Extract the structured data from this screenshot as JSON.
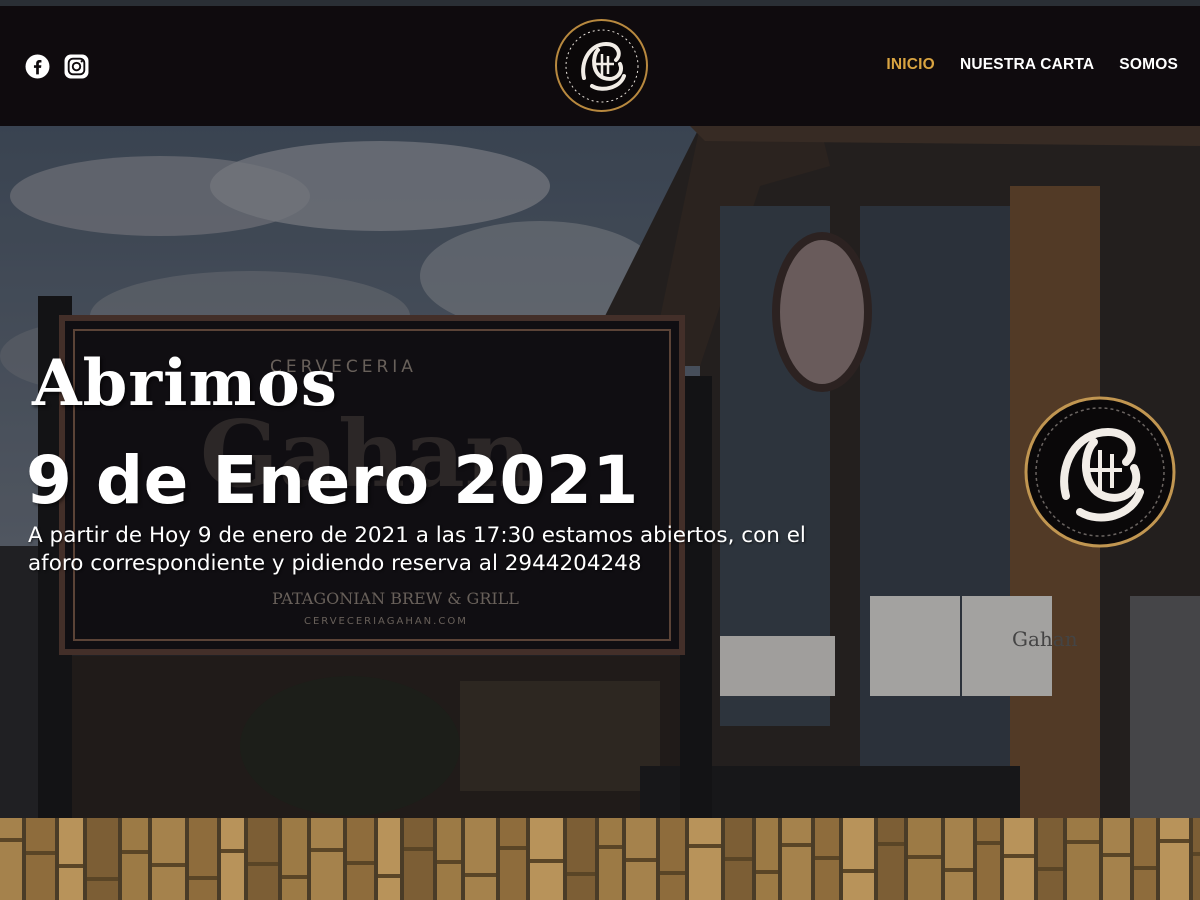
{
  "header": {
    "social": [
      {
        "name": "facebook",
        "icon": "facebook-icon"
      },
      {
        "name": "instagram",
        "icon": "instagram-icon"
      }
    ],
    "logo_icon": "gahan-logo-icon",
    "nav": [
      {
        "label": "INICIO",
        "active": true
      },
      {
        "label": "NUESTRA CARTA",
        "active": false
      },
      {
        "label": "SOMOS",
        "active": false
      }
    ]
  },
  "hero": {
    "title": "Abrimos",
    "date": "9 de Enero 2021",
    "text": "A partir de Hoy 9 de enero de 2021 a las 17:30 estamos abiertos, con el aforo correspondiente y pidiendo reserva al 2944204248",
    "sign": {
      "line1": "CERVECERIA",
      "brand": "Gahan",
      "line2": "PATAGONIAN BREW & GRILL",
      "url": "CERVECERIAGAHAN.COM"
    },
    "window_text": "Gahan"
  },
  "colors": {
    "accent": "#d9a441",
    "header_bg": "#0f0b0e",
    "text": "#ffffff"
  }
}
